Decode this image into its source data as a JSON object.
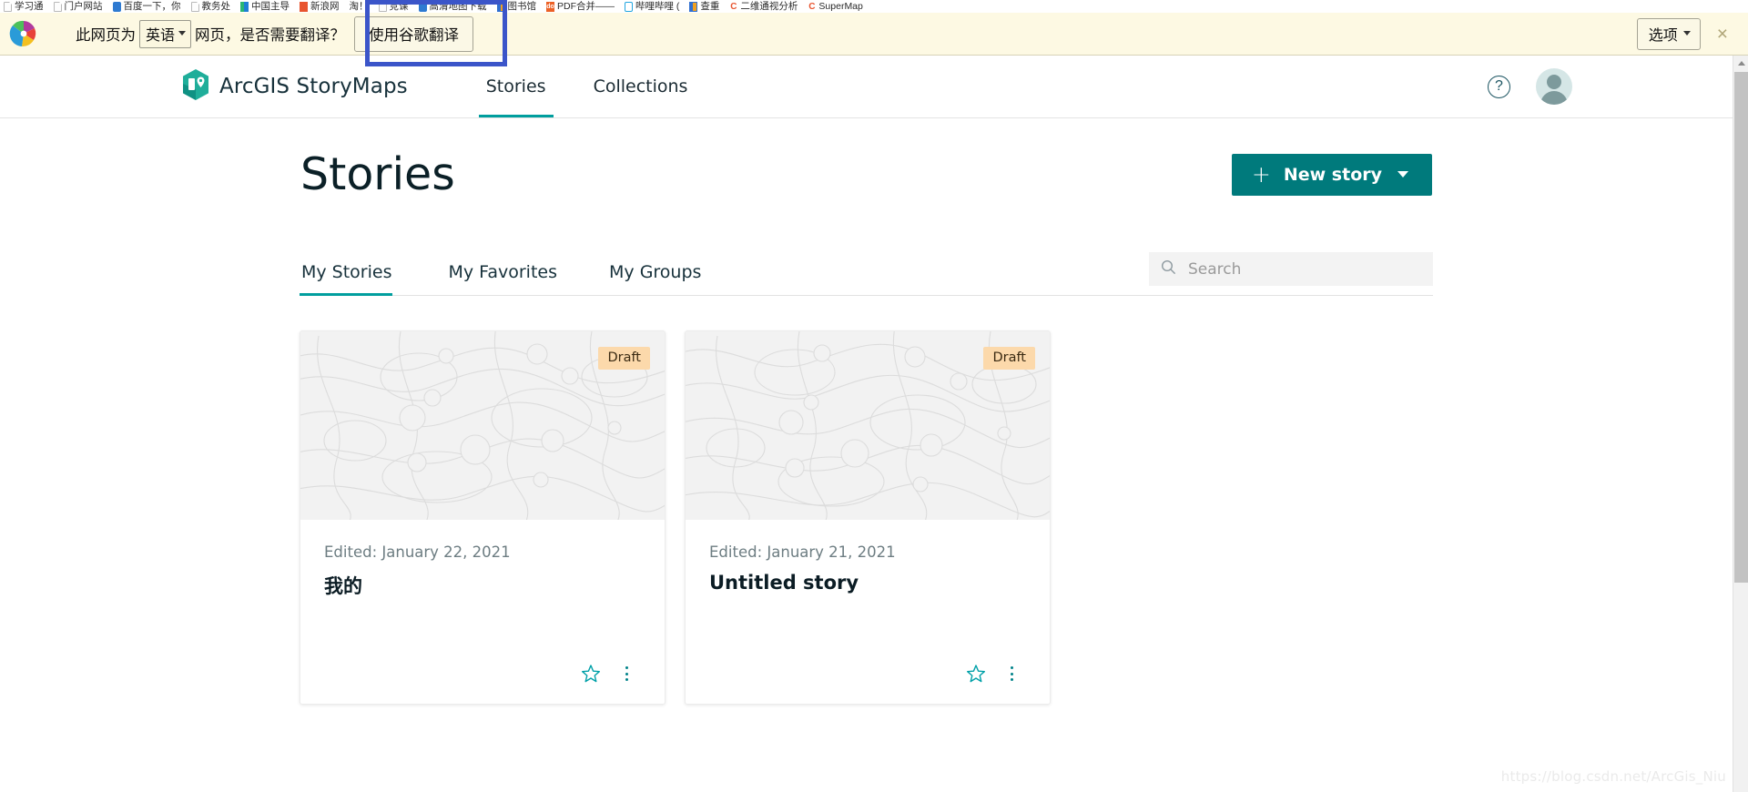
{
  "browser": {
    "bookmarks": [
      {
        "label": "学习通",
        "icon": "page-icon"
      },
      {
        "label": "门户网站",
        "icon": "page-icon"
      },
      {
        "label": "百度一下，你",
        "icon": "baidu-icon"
      },
      {
        "label": "教务处",
        "icon": "page-icon"
      },
      {
        "label": "中国主导",
        "icon": "green-icon"
      },
      {
        "label": "新浪网",
        "icon": "orange-icon"
      },
      {
        "label": "淘！",
        "icon": "page-icon"
      },
      {
        "label": "竞课",
        "icon": "page-icon"
      },
      {
        "label": "高清地图下载",
        "icon": "map-icon"
      },
      {
        "label": "图书馆",
        "icon": "book-icon"
      },
      {
        "label": "PDF合并——",
        "icon": "pdf-icon"
      },
      {
        "label": "哔哩哔哩 (",
        "icon": "bilibili-icon"
      },
      {
        "label": "查重",
        "icon": "book-icon"
      },
      {
        "label": "二维通视分析",
        "icon": "c-icon"
      },
      {
        "label": "SuperMap",
        "icon": "c-icon"
      }
    ]
  },
  "translate_bar": {
    "prefix": "此网页为",
    "language": "英语",
    "suffix": "网页，是否需要翻译？",
    "translate_button": "使用谷歌翻译",
    "options_button": "选项",
    "close_label": "×",
    "background": "#fdf9e3",
    "highlight_color": "#3b55c9"
  },
  "header": {
    "brand": "ArcGIS StoryMaps",
    "nav": [
      {
        "label": "Stories",
        "active": true
      },
      {
        "label": "Collections",
        "active": false
      }
    ],
    "help_label": "?",
    "accent": "#009e9e"
  },
  "main": {
    "title": "Stories",
    "new_story_button": "New story",
    "new_story_plus": "+",
    "button_color": "#007a7c",
    "tabs": [
      {
        "label": "My Stories",
        "active": true
      },
      {
        "label": "My Favorites",
        "active": false
      },
      {
        "label": "My Groups",
        "active": false
      }
    ],
    "search": {
      "placeholder": "Search",
      "value": "",
      "icon": "search-icon"
    },
    "cards": [
      {
        "badge": "Draft",
        "date": "Edited: January 22, 2021",
        "name": "我的",
        "favorite_icon": "star-icon",
        "menu_icon": "kebab-menu-icon"
      },
      {
        "badge": "Draft",
        "date": "Edited: January 21, 2021",
        "name": "Untitled story",
        "favorite_icon": "star-icon",
        "menu_icon": "kebab-menu-icon"
      }
    ]
  },
  "watermark": "https://blog.csdn.net/ArcGis_Niu"
}
